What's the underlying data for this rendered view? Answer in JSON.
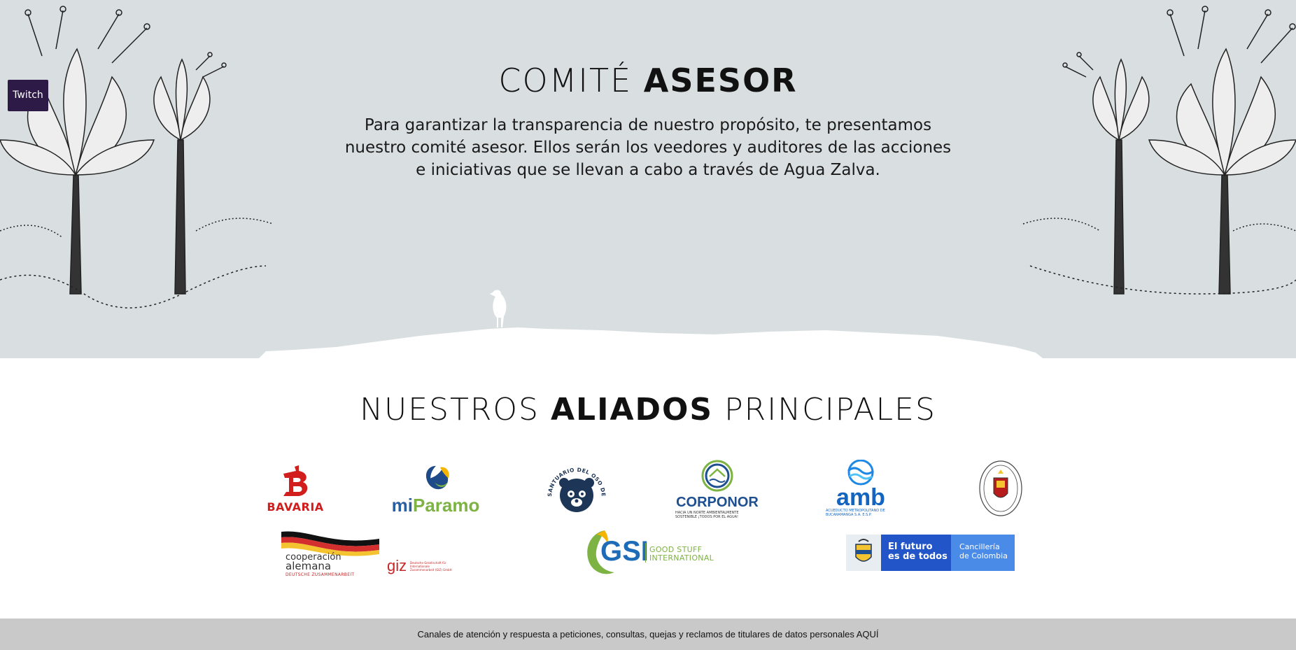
{
  "floating": {
    "twitch_label": "Twitch"
  },
  "committee": {
    "title_light": "COMITÉ",
    "title_bold": "ASESOR",
    "description": "Para garantizar la transparencia de nuestro propósito, te presentamos nuestro comité asesor. Ellos serán los veedores y auditores de las acciones e iniciativas que se llevan a cabo a través de Agua Zalva."
  },
  "allies": {
    "title_light_1": "NUESTROS",
    "title_bold": "ALIADOS",
    "title_light_2": "PRINCIPALES",
    "logos": {
      "bavaria": "BAVARIA",
      "miparamo_mi": "mi",
      "miparamo_paramo": "Paramo",
      "oso": "SANTUARIO DEL OSO DE ANTEOJOS",
      "corponor": "CORPONOR",
      "corponor_sub": "HACIA UN NORTE AMBIENTALMENTE SOSTENIBLE ¡TODOS POR EL AGUA!",
      "amb": "amb",
      "amb_sub": "ACUEDUCTO METROPOLITANO DE BUCARAMANGA S.A. E.S.P.",
      "coop_line1": "cooperación",
      "coop_line2": "alemana",
      "coop_deutsch": "DEUTSCHE ZUSAMMENARBEIT",
      "giz": "giz",
      "giz_sub": "Deutsche Gesellschaft für Internationale Zusammenarbeit (GIZ) GmbH",
      "gsi": "GSI",
      "gsi_tag1": "GOOD STUFF",
      "gsi_tag2": "INTERNATIONAL",
      "gov_line1": "El futuro",
      "gov_line2": "es de todos",
      "gov_line3": "Cancillería",
      "gov_line4": "de Colombia"
    }
  },
  "footer": {
    "text": "Canales de atención y respuesta a peticiones, consultas, quejas y reclamos de titulares de datos personales AQUÍ"
  },
  "colors": {
    "hero_bg": "#d9dfe0",
    "twitch_bg": "#2e1a47",
    "footer_bg": "#c9c9c9"
  }
}
